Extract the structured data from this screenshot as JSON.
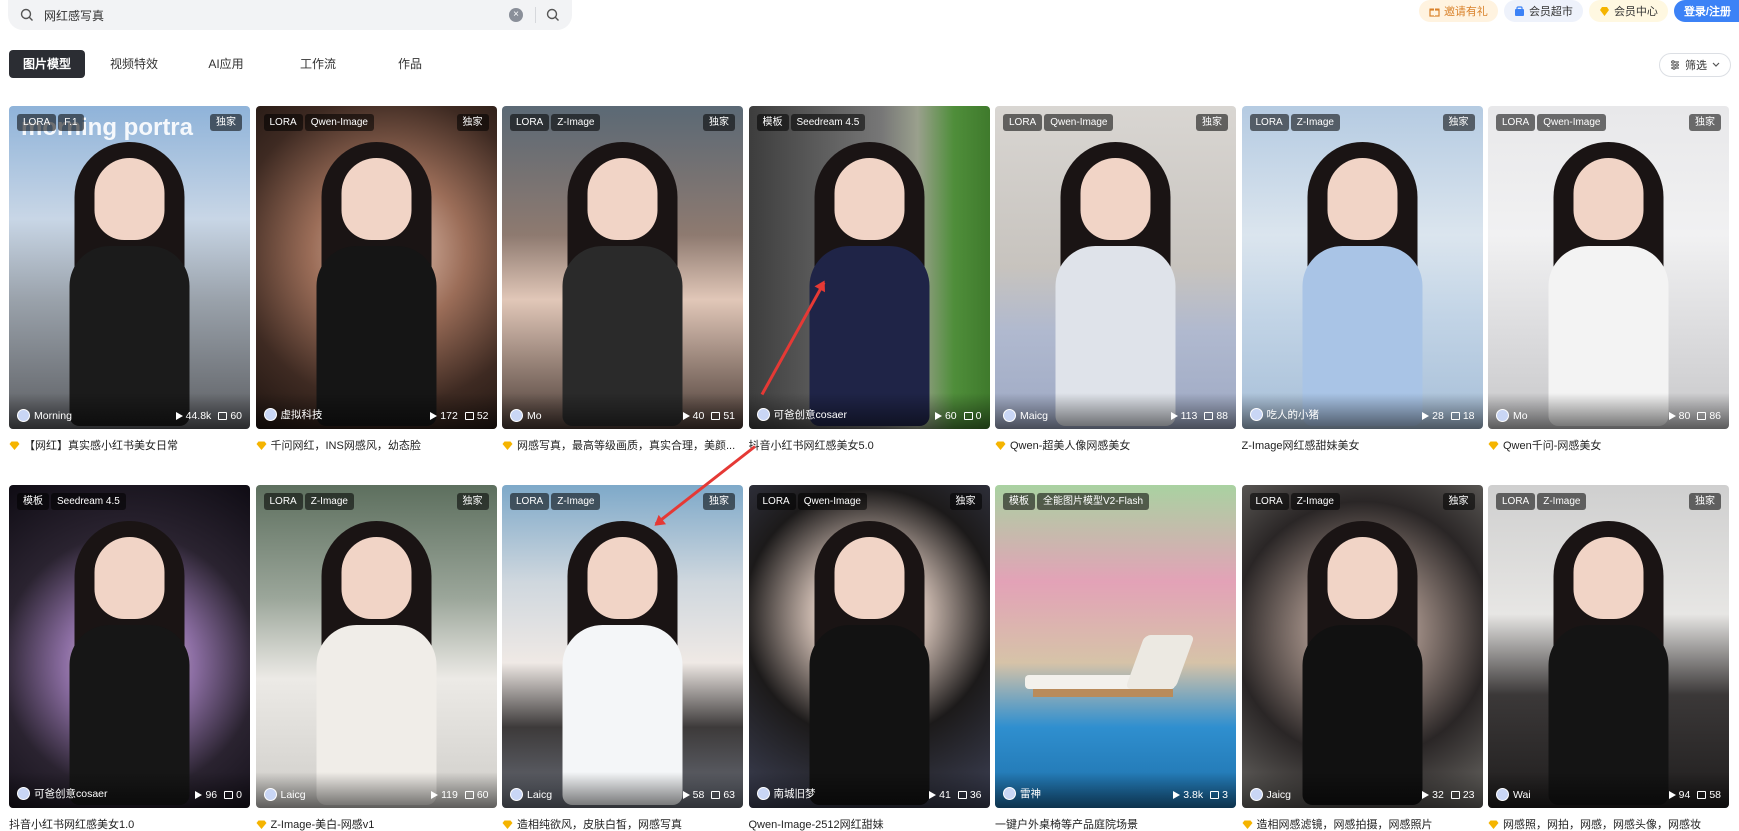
{
  "search": {
    "value": "网红感写真",
    "clear": "×"
  },
  "header": {
    "invite": "邀请有礼",
    "supermarket": "会员超市",
    "member_center": "会员中心",
    "login": "登录/注册"
  },
  "tabs": [
    {
      "label": "图片模型"
    },
    {
      "label": "视频特效"
    },
    {
      "label": "AI应用"
    },
    {
      "label": "工作流"
    },
    {
      "label": "作品"
    }
  ],
  "filter": {
    "label": "筛选"
  },
  "colors": {
    "accent": "#3c82f6",
    "tab_active_bg": "#2b2d33",
    "arrow": "#e53935",
    "invite": "#d9822b"
  },
  "cards": [
    {
      "tag1": "LORA",
      "tag2": "F.1",
      "exclusive": "独家",
      "overlay": "morning portra",
      "author": "Morning",
      "runs": "44.8k",
      "downloads": "60",
      "caption": "【网红】真实感小红书美女日常",
      "has_icon": true
    },
    {
      "tag1": "LORA",
      "tag2": "Qwen-Image",
      "exclusive": "独家",
      "author": "虚拟科技",
      "runs": "172",
      "downloads": "52",
      "caption": "千问网红，INS网感风，幼态脸",
      "has_icon": true
    },
    {
      "tag1": "LORA",
      "tag2": "Z-Image",
      "exclusive": "独家",
      "author": "Mo",
      "runs": "40",
      "downloads": "51",
      "caption": "网感写真，最高等级画质，真实合理，美颜...",
      "has_icon": true
    },
    {
      "tag1": "模板",
      "tag2": "Seedream 4.5",
      "exclusive": "",
      "author": "可爸创意cosaer",
      "runs": "60",
      "downloads": "0",
      "caption": "抖音小红书网红感美女5.0",
      "has_icon": false
    },
    {
      "tag1": "LORA",
      "tag2": "Qwen-Image",
      "exclusive": "独家",
      "author": "Maicg",
      "runs": "113",
      "downloads": "88",
      "caption": "Qwen-超美人像网感美女",
      "has_icon": true
    },
    {
      "tag1": "LORA",
      "tag2": "Z-Image",
      "exclusive": "独家",
      "author": "吃人的小猪",
      "runs": "28",
      "downloads": "18",
      "caption": "Z-Image网红感甜妹美女",
      "has_icon": false
    },
    {
      "tag1": "LORA",
      "tag2": "Qwen-Image",
      "exclusive": "独家",
      "author": "Mo",
      "runs": "80",
      "downloads": "86",
      "caption": "Qwen千问-网感美女",
      "has_icon": true
    },
    {
      "tag1": "模板",
      "tag2": "Seedream 4.5",
      "exclusive": "",
      "author": "可爸创意cosaer",
      "runs": "96",
      "downloads": "0",
      "caption": "抖音小红书网红感美女1.0",
      "has_icon": false
    },
    {
      "tag1": "LORA",
      "tag2": "Z-Image",
      "exclusive": "独家",
      "author": "Laicg",
      "runs": "119",
      "downloads": "60",
      "caption": "Z-Image-美白-网感v1",
      "has_icon": true
    },
    {
      "tag1": "LORA",
      "tag2": "Z-Image",
      "exclusive": "独家",
      "author": "Laicg",
      "runs": "58",
      "downloads": "63",
      "caption": "造相纯欲风，皮肤白皙，网感写真",
      "has_icon": true
    },
    {
      "tag1": "LORA",
      "tag2": "Qwen-Image",
      "exclusive": "独家",
      "author": "南城旧梦",
      "runs": "41",
      "downloads": "36",
      "caption": "Qwen-Image-2512网红甜妹",
      "has_icon": false
    },
    {
      "tag1": "模板",
      "tag2": "全能图片模型V2-Flash",
      "exclusive": "",
      "author": "雷神",
      "runs": "3.8k",
      "downloads": "3",
      "caption": "一键户外桌椅等产品庭院场景",
      "has_icon": false
    },
    {
      "tag1": "LORA",
      "tag2": "Z-Image",
      "exclusive": "独家",
      "author": "Jaicg",
      "runs": "32",
      "downloads": "23",
      "caption": "造相网感滤镜，网感拍摄，网感照片",
      "has_icon": true
    },
    {
      "tag1": "LORA",
      "tag2": "Z-Image",
      "exclusive": "独家",
      "author": "Wai",
      "runs": "94",
      "downloads": "58",
      "caption": "网感照，网拍，网感，网感头像，网感妆",
      "has_icon": true
    }
  ]
}
